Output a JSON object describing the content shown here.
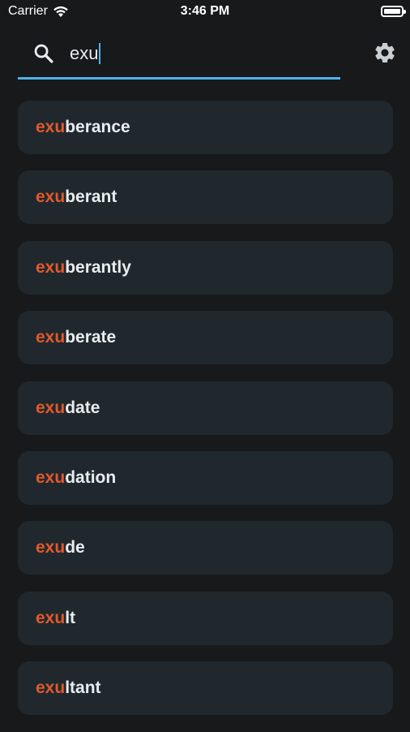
{
  "status": {
    "carrier": "Carrier",
    "time": "3:46 PM"
  },
  "search": {
    "query": "exu"
  },
  "icons": {
    "search": "search-icon",
    "settings": "gear-icon",
    "wifi": "wifi-icon",
    "battery": "battery-icon"
  },
  "colors": {
    "background": "#18191b",
    "card": "#20282d",
    "accent": "#4fb3e8",
    "match": "#e0592d",
    "text": "#e9ecef"
  },
  "results": [
    {
      "match": "exu",
      "rest": "berance"
    },
    {
      "match": "exu",
      "rest": "berant"
    },
    {
      "match": "exu",
      "rest": "berantly"
    },
    {
      "match": "exu",
      "rest": "berate"
    },
    {
      "match": "exu",
      "rest": "date"
    },
    {
      "match": "exu",
      "rest": "dation"
    },
    {
      "match": "exu",
      "rest": "de"
    },
    {
      "match": "exu",
      "rest": "lt"
    },
    {
      "match": "exu",
      "rest": "ltant"
    }
  ]
}
